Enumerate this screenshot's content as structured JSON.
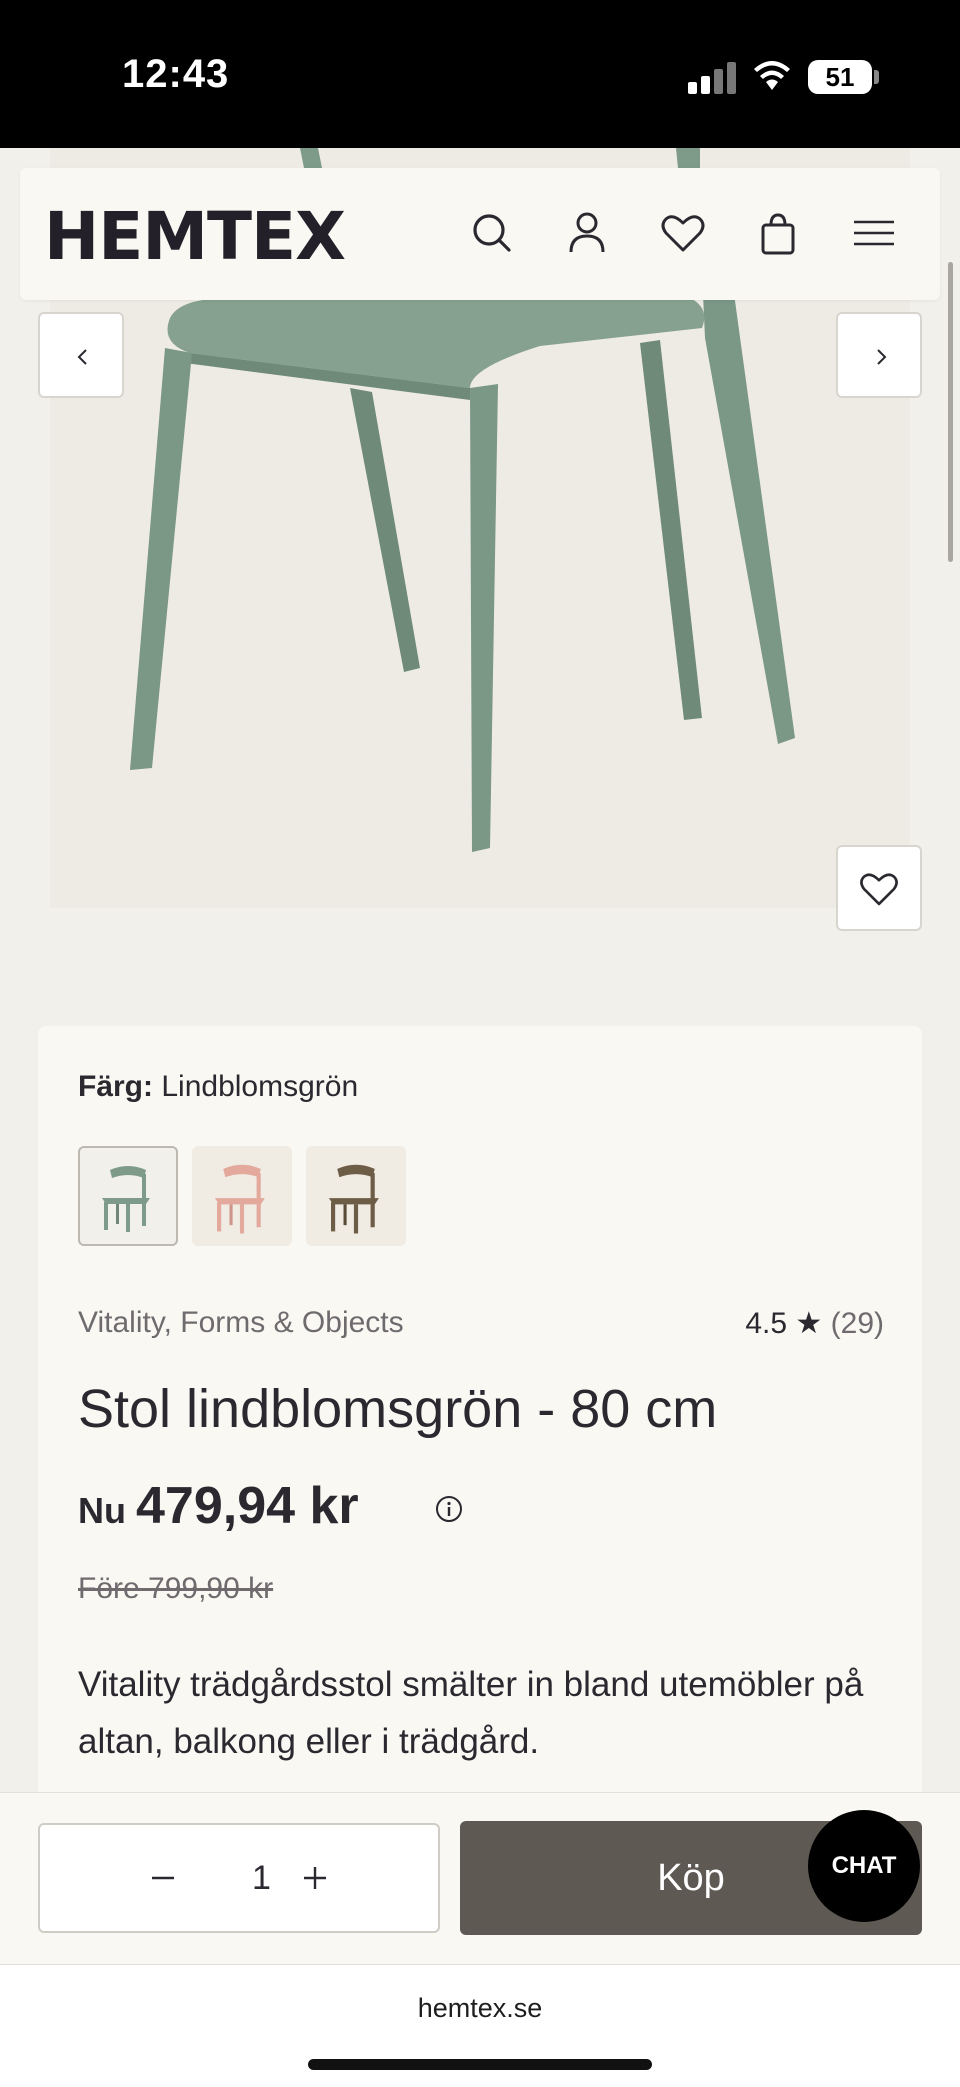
{
  "status_bar": {
    "time": "12:43",
    "battery": "51"
  },
  "header": {
    "logo": "HEMTEX",
    "icons": [
      "search-icon",
      "account-icon",
      "wishlist-icon",
      "cart-icon",
      "menu-icon"
    ]
  },
  "gallery": {
    "prev_icon": "chevron-left-icon",
    "next_icon": "chevron-right-icon",
    "favorite_icon": "heart-icon"
  },
  "product": {
    "color_label": "Färg:",
    "color_value": "Lindblomsgrön",
    "swatches": [
      {
        "name": "Lindblomsgrön",
        "color": "#7e9a88"
      },
      {
        "name": "Rosa",
        "color": "#e3a99d"
      },
      {
        "name": "Brun",
        "color": "#6e5d46"
      }
    ],
    "brand": "Vitality, Forms & Objects",
    "rating": "4.5 ★",
    "rating_count": "(29)",
    "title": "Stol lindblomsgrön - 80 cm",
    "price_prefix": "Nu",
    "price": "479,94 kr",
    "was_price": "Före 799,90 kr",
    "description": "Vitality trädgårdsstol smälter in bland utemöbler på altan, balkong eller i trädgård."
  },
  "buy_bar": {
    "quantity": "1",
    "buy_label": "Köp",
    "chat_label": "CHAT"
  },
  "browser": {
    "url": "hemtex.se"
  },
  "colors": {
    "chair": "#7e9a88",
    "buy_button": "#5f5954",
    "page_bg": "#f2f0ea"
  }
}
